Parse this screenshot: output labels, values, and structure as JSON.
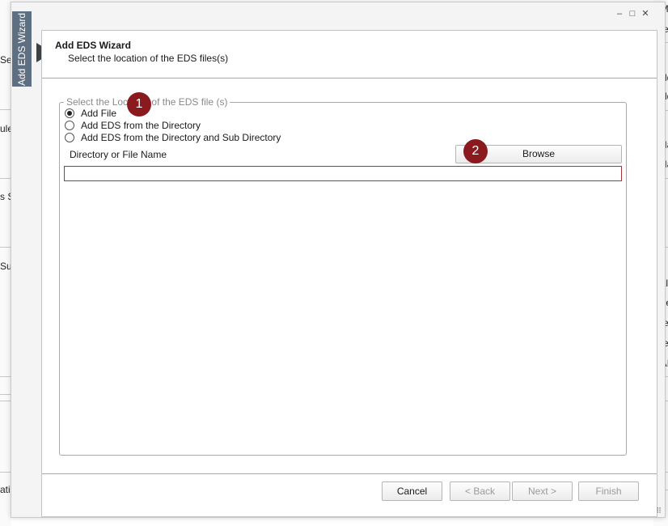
{
  "background": {
    "left_fragments": [
      "Se",
      "ule",
      "s Se",
      "Sup",
      "ati"
    ],
    "right_fragments": [
      "t M",
      "ate",
      "Add",
      "Add",
      "Na",
      "Na",
      "ud",
      "ud",
      "nal",
      "ede",
      "nte",
      "me",
      "LAI"
    ]
  },
  "window": {
    "minimize_glyph": "–",
    "maximize_glyph": "□",
    "close_glyph": "✕"
  },
  "side_tab": {
    "label": "Add EDS Wizard"
  },
  "header": {
    "title": "Add EDS Wizard",
    "subtitle": "Select the location of the EDS files(s)"
  },
  "group": {
    "legend": "Select the Location of the EDS file (s)",
    "options": [
      {
        "label": "Add File",
        "checked": true
      },
      {
        "label": "Add EDS from the Directory",
        "checked": false
      },
      {
        "label": "Add EDS from the Directory and Sub Directory",
        "checked": false
      }
    ],
    "dir_label": "Directory or File Name",
    "browse_label": "Browse",
    "file_value": ""
  },
  "badges": [
    "1",
    "2"
  ],
  "footer": {
    "cancel": "Cancel",
    "back": "< Back",
    "next": "Next >",
    "finish": "Finish"
  },
  "colors": {
    "accent_badge": "#8b1a1f",
    "side_tab": "#5e6f82",
    "input_border": "#a4343a"
  }
}
